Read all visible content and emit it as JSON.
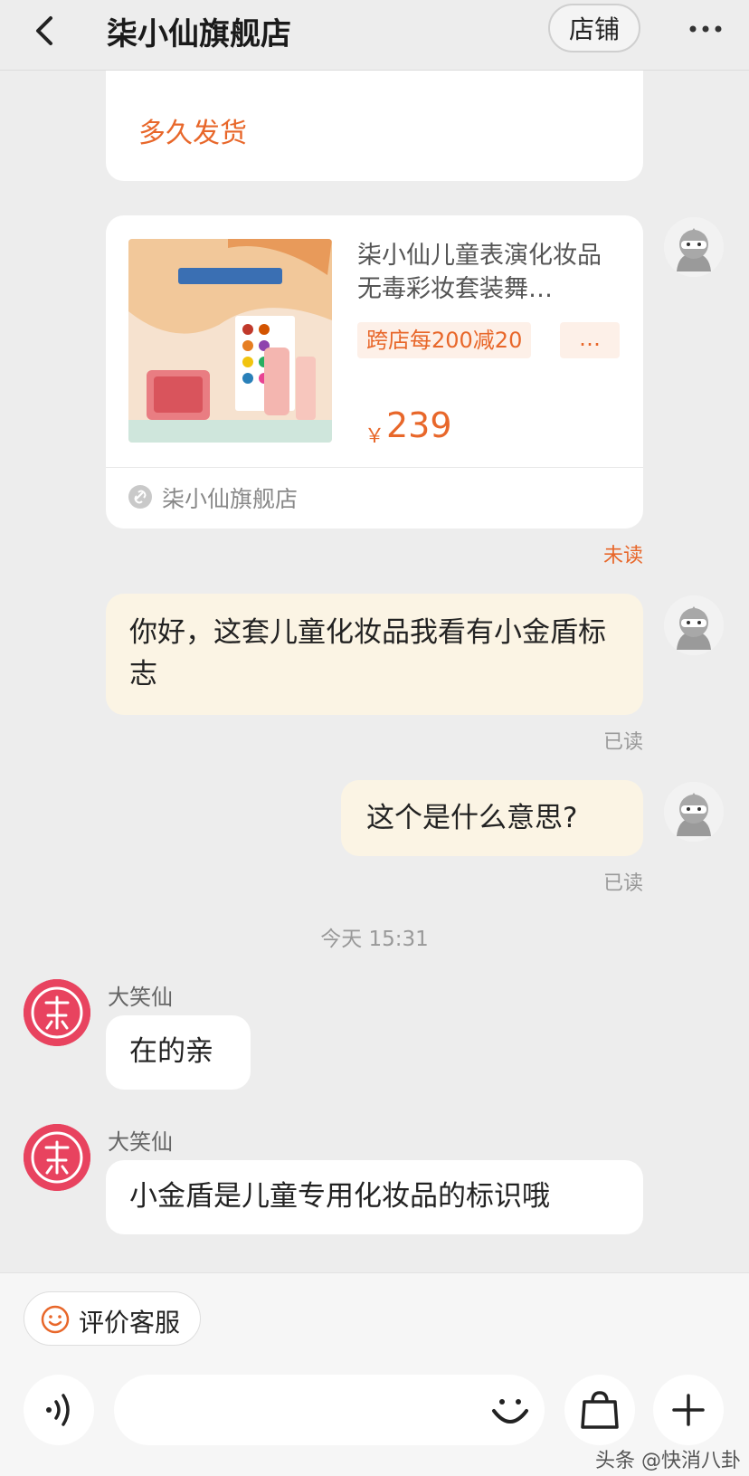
{
  "header": {
    "title": "柒小仙旗舰店",
    "shop_button": "店铺",
    "back_icon": "chevron-left-icon",
    "more_icon": "more-dots-icon"
  },
  "top_card": {
    "quick_reply": "多久发货"
  },
  "product_card": {
    "title": "柒小仙儿童表演化妆品无毒彩妆套装舞…",
    "promo": "跨店每200减20",
    "promo_more": "…",
    "currency": "￥",
    "price": "239",
    "shop_name": "柒小仙旗舰店",
    "unread_label": "未读"
  },
  "messages": [
    {
      "sender": "me",
      "text": "你好，这套儿童化妆品我看有小金盾标志",
      "status": "已读"
    },
    {
      "sender": "me",
      "text": "这个是什么意思?",
      "status": "已读"
    },
    {
      "timestamp": "今天 15:31"
    },
    {
      "sender": "大笑仙",
      "text": "在的亲"
    },
    {
      "sender": "大笑仙",
      "text": "小金盾是儿童专用化妆品的标识哦"
    }
  ],
  "bottom_bar": {
    "rate_button": "评价客服",
    "input_placeholder": "",
    "voice_icon": "voice-icon",
    "emoji_icon": "emoji-icon",
    "bag_icon": "shopping-bag-icon",
    "plus_icon": "plus-icon"
  },
  "watermark": "头条 @快消八卦",
  "colors": {
    "accent": "#e8672a",
    "background": "#ededed",
    "my_bubble": "#fbf4e4",
    "shop_avatar": "#e8435f"
  }
}
